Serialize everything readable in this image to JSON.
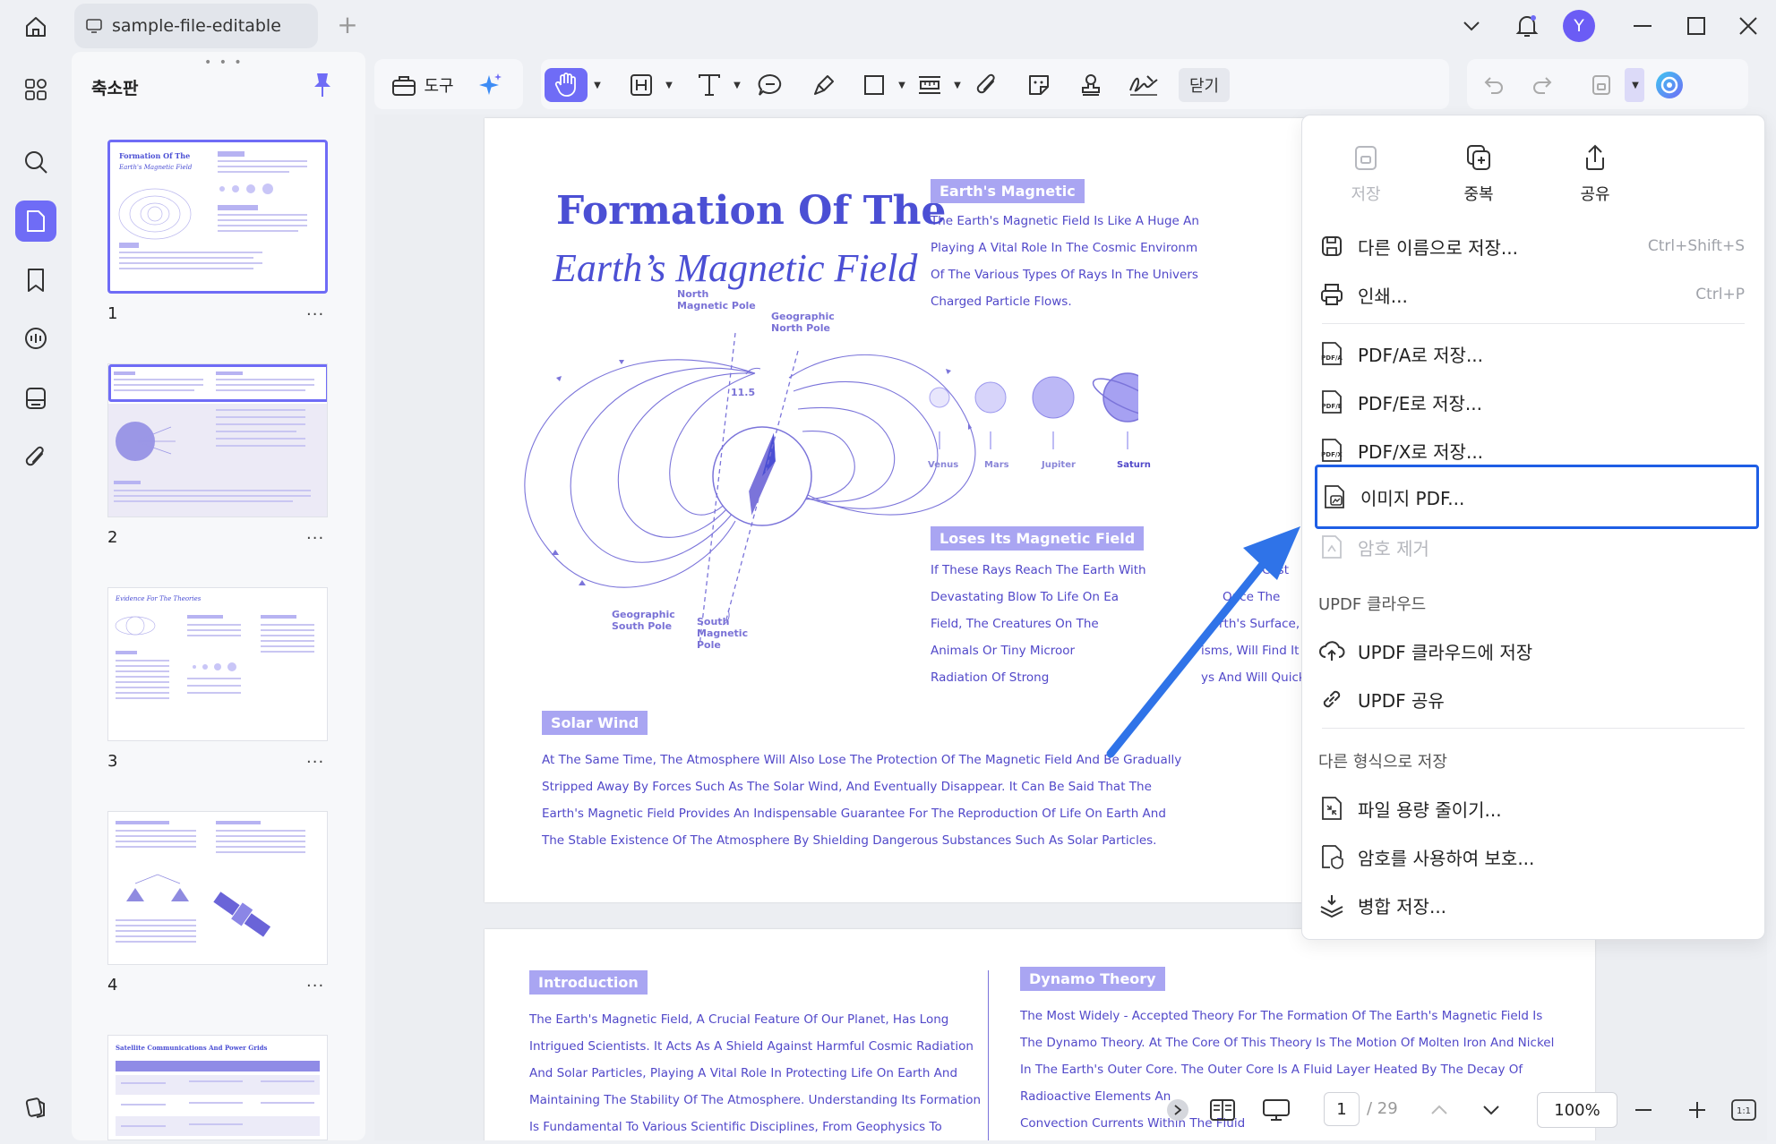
{
  "titlebar": {
    "tab_title": "sample-file-editable",
    "avatar_initial": "Y"
  },
  "thumbnails": {
    "title": "축소판",
    "pages": [
      {
        "number": "1",
        "more": "..."
      },
      {
        "number": "2",
        "more": "..."
      },
      {
        "number": "3",
        "more": "..."
      },
      {
        "number": "4",
        "more": "..."
      }
    ]
  },
  "toolbar": {
    "tools_label": "도구",
    "close_label": "닫기"
  },
  "document": {
    "page1": {
      "title_line1": "Formation Of The",
      "title_line2": "Earth’s Magnetic Field",
      "diagram": {
        "north_magnetic_pole": "North\nMagnetic Pole",
        "geographic_north_pole": "Geographic\nNorth Pole",
        "angle": "11.5",
        "geographic_south_pole": "Geographic\nSouth Pole",
        "south_magnetic_pole": "South\nMagnetic\nPole"
      },
      "earths_magnetic": {
        "heading": "Earth's Magnetic",
        "lines": [
          "The Earth's Magnetic Field Is Like A Huge An",
          "Playing A Vital Role In The Cosmic Environm",
          "Of The Various Types Of Rays In The Univers",
          "Charged Particle Flows."
        ]
      },
      "planets": [
        "Venus",
        "Mars",
        "Jupiter",
        "Saturn"
      ],
      "loses": {
        "heading": "Loses Its Magnetic Field",
        "lines": [
          "If These Rays Reach The Earth With",
          "Devastating Blow To Life On Ea",
          "Field, The Creatures On The",
          "Animals Or Tiny Microor",
          "Radiation Of Strong"
        ],
        "tails": [
          "Cost",
          "Once The",
          "rth's Surface,",
          "isms, Will Find It",
          "ys And Will Quickly G"
        ]
      },
      "solar_wind": {
        "heading": "Solar Wind",
        "lines": [
          "At The Same Time, The Atmosphere Will Also Lose The Protection Of The Magnetic Field And Be Gradually",
          "Stripped Away By Forces Such As The Solar Wind, And Eventually Disappear. It Can Be Said That The",
          "Earth's Magnetic Field Provides An Indispensable Guarantee For The Reproduction Of Life On Earth And",
          "The Stable Existence Of The Atmosphere By Shielding Dangerous Substances Such As Solar Particles."
        ]
      }
    },
    "page2": {
      "introduction": {
        "heading": "Introduction",
        "lines": [
          "The Earth's Magnetic Field, A Crucial Feature Of Our Planet, Has Long",
          "Intrigued Scientists. It Acts As A Shield Against Harmful Cosmic Radiation",
          "And Solar Particles, Playing A Vital Role In Protecting Life On Earth And",
          "Maintaining The Stability Of The Atmosphere. Understanding Its Formation",
          "Is Fundamental To Various Scientific Disciplines, From Geophysics To"
        ]
      },
      "dynamo": {
        "heading": "Dynamo Theory",
        "lines": [
          "The Most Widely - Accepted Theory For The Formation Of The Earth's Magnetic Field Is",
          "The Dynamo Theory. At The Core Of This Theory Is The Motion Of Molten Iron And Nickel",
          "In The Earth's Outer Core. The Outer Core Is A Fluid Layer Heated By The Decay Of",
          "Radioactive Elements An",
          "Convection Currents Within The Fluid"
        ]
      }
    }
  },
  "menu": {
    "top_actions": [
      {
        "label": "저장",
        "icon": "save-icon",
        "disabled": true
      },
      {
        "label": "중복",
        "icon": "duplicate-icon",
        "disabled": false
      },
      {
        "label": "공유",
        "icon": "share-icon",
        "disabled": false
      }
    ],
    "save_as": {
      "label": "다른 이름으로 저장...",
      "shortcut": "Ctrl+Shift+S"
    },
    "print": {
      "label": "인쇄...",
      "shortcut": "Ctrl+P"
    },
    "pdfa": "PDF/A로 저장...",
    "pdfe": "PDF/E로 저장...",
    "pdfx": "PDF/X로 저장...",
    "image_pdf": "이미지 PDF...",
    "remove_password": "암호 제거",
    "cloud_section": "UPDF 클라우드",
    "save_to_cloud": "UPDF 클라우드에 저장",
    "updf_share": "UPDF 공유",
    "other_section": "다른 형식으로 저장",
    "reduce_size": "파일 용량 줄이기...",
    "protect_password": "암호를 사용하여 보호...",
    "flatten_save": "병합 저장..."
  },
  "bottombar": {
    "current_page": "1",
    "total_pages": "/ 29",
    "zoom": "100%"
  },
  "colors": {
    "accent": "#6f6cf6",
    "doc_purple": "#4b4fd4",
    "highlight_blue": "#1e5ee5",
    "arrow_blue": "#2f73e8"
  }
}
